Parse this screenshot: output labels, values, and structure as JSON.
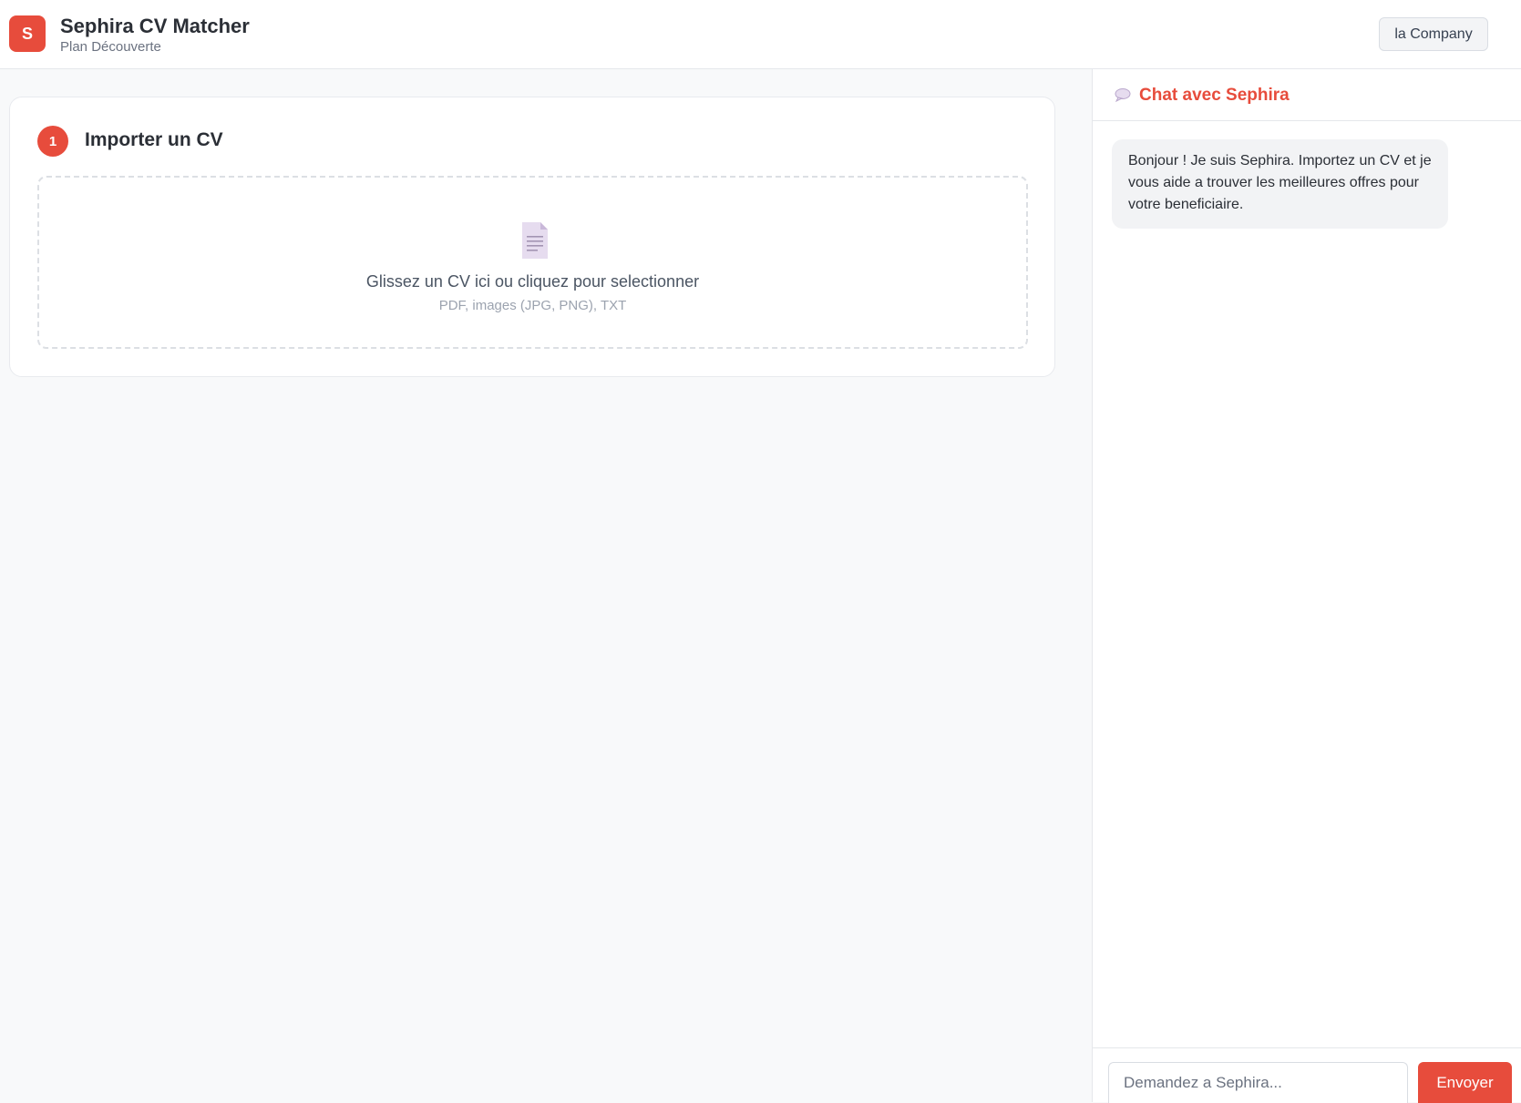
{
  "header": {
    "logo_letter": "S",
    "title": "Sephira CV Matcher",
    "plan": "Plan Découverte",
    "company_button": "la Company"
  },
  "upload": {
    "step_number": "1",
    "step_title": "Importer un CV",
    "icon": "document-icon",
    "drop_text": "Glissez un CV ici ou cliquez pour selectionner",
    "drop_formats": "PDF, images (JPG, PNG), TXT"
  },
  "chat": {
    "icon": "speech-bubble-icon",
    "title": "Chat avec Sephira",
    "welcome_message": "Bonjour ! Je suis Sephira. Importez un CV et je vous aide a trouver les meilleures offres pour votre beneficiaire.",
    "input_placeholder": "Demandez a Sephira...",
    "send_label": "Envoyer"
  },
  "colors": {
    "accent": "#e74c3c",
    "background": "#f8f9fa",
    "bubble": "#f2f3f5"
  }
}
